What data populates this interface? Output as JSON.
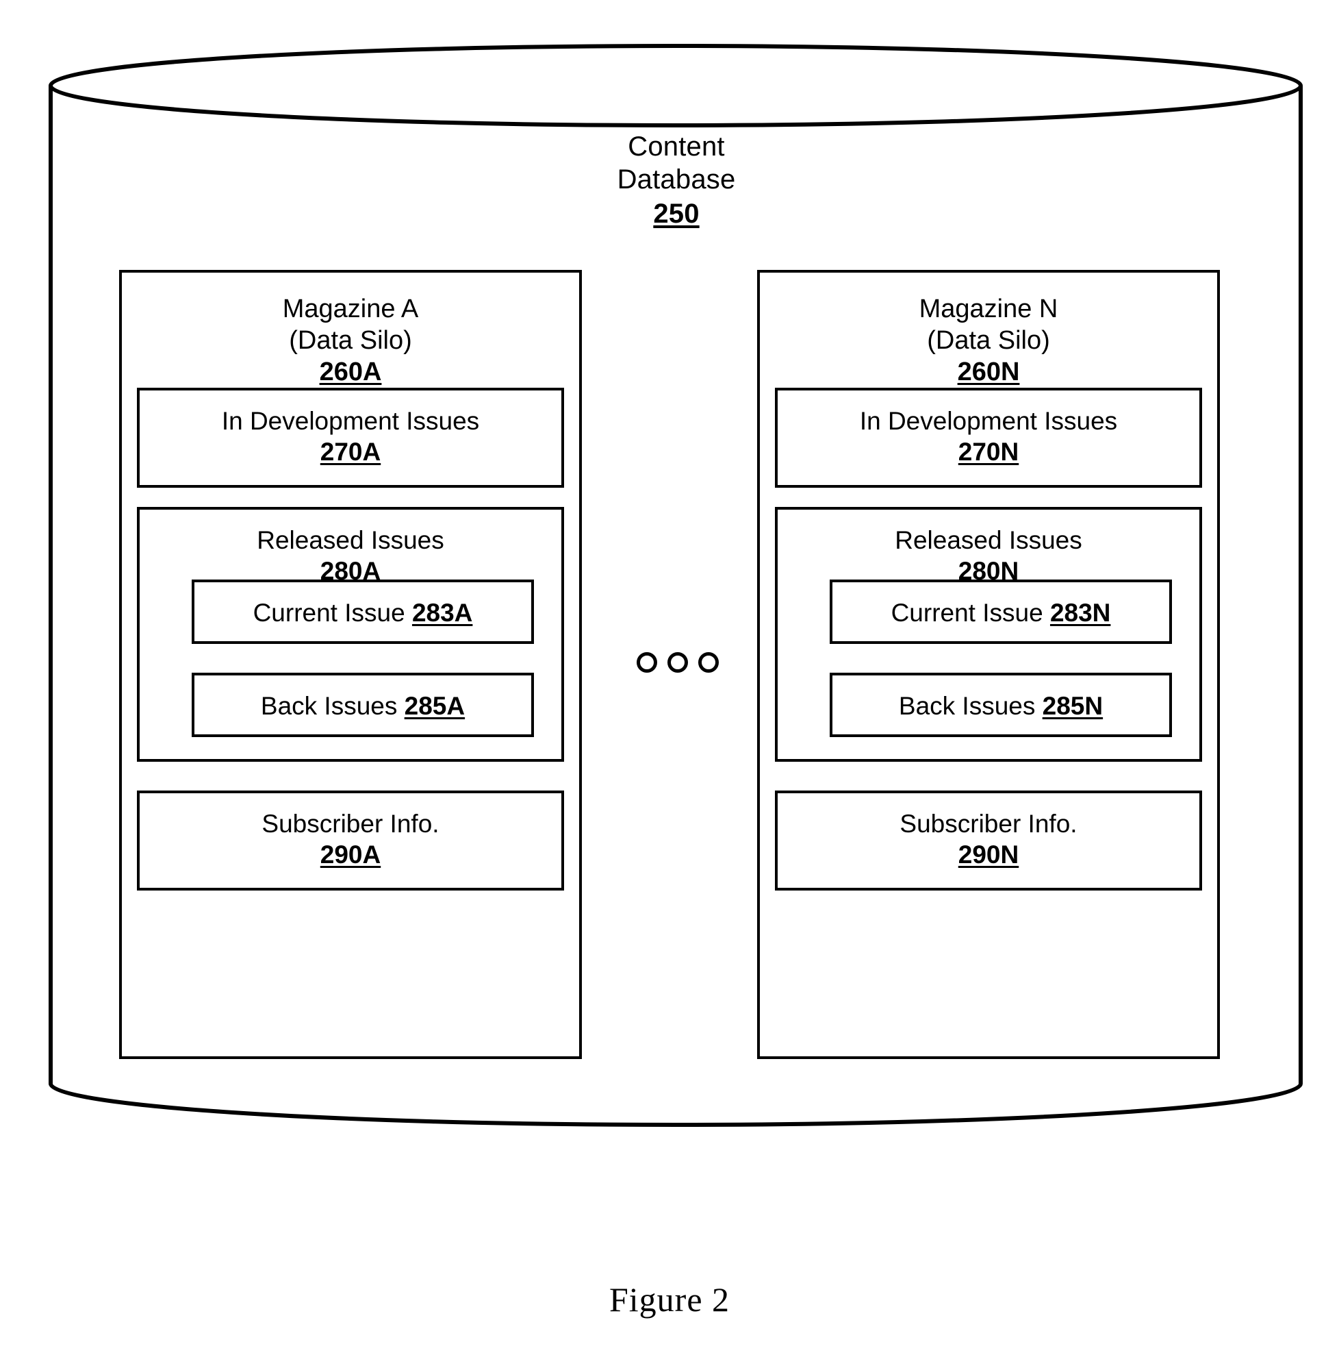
{
  "figure": {
    "caption": "Figure 2"
  },
  "database": {
    "name": "Content\nDatabase",
    "title_line1": "Content",
    "title_line2": "Database",
    "ref": "250",
    "shape": "cylinder"
  },
  "ellipsis": {
    "symbol": "circle",
    "count": 3,
    "meaning": "additional data silos"
  },
  "silos": [
    {
      "id": "silo-a",
      "title_line1": "Magazine A",
      "title_line2": "(Data Silo)",
      "ref": "260A",
      "in_development": {
        "label": "In Development Issues",
        "ref": "270A"
      },
      "released": {
        "label": "Released Issues",
        "ref": "280A",
        "current_issue": {
          "label": "Current Issue",
          "ref": "283A"
        },
        "back_issues": {
          "label": "Back Issues",
          "ref": "285A"
        }
      },
      "subscriber_info": {
        "label": "Subscriber Info.",
        "ref": "290A"
      }
    },
    {
      "id": "silo-n",
      "title_line1": "Magazine N",
      "title_line2": "(Data Silo)",
      "ref": "260N",
      "in_development": {
        "label": "In Development Issues",
        "ref": "270N"
      },
      "released": {
        "label": "Released Issues",
        "ref": "280N",
        "current_issue": {
          "label": "Current Issue",
          "ref": "283N"
        },
        "back_issues": {
          "label": "Back Issues",
          "ref": "285N"
        }
      },
      "subscriber_info": {
        "label": "Subscriber Info.",
        "ref": "290N"
      }
    }
  ],
  "colors": {
    "stroke": "#000000",
    "background": "#ffffff"
  }
}
